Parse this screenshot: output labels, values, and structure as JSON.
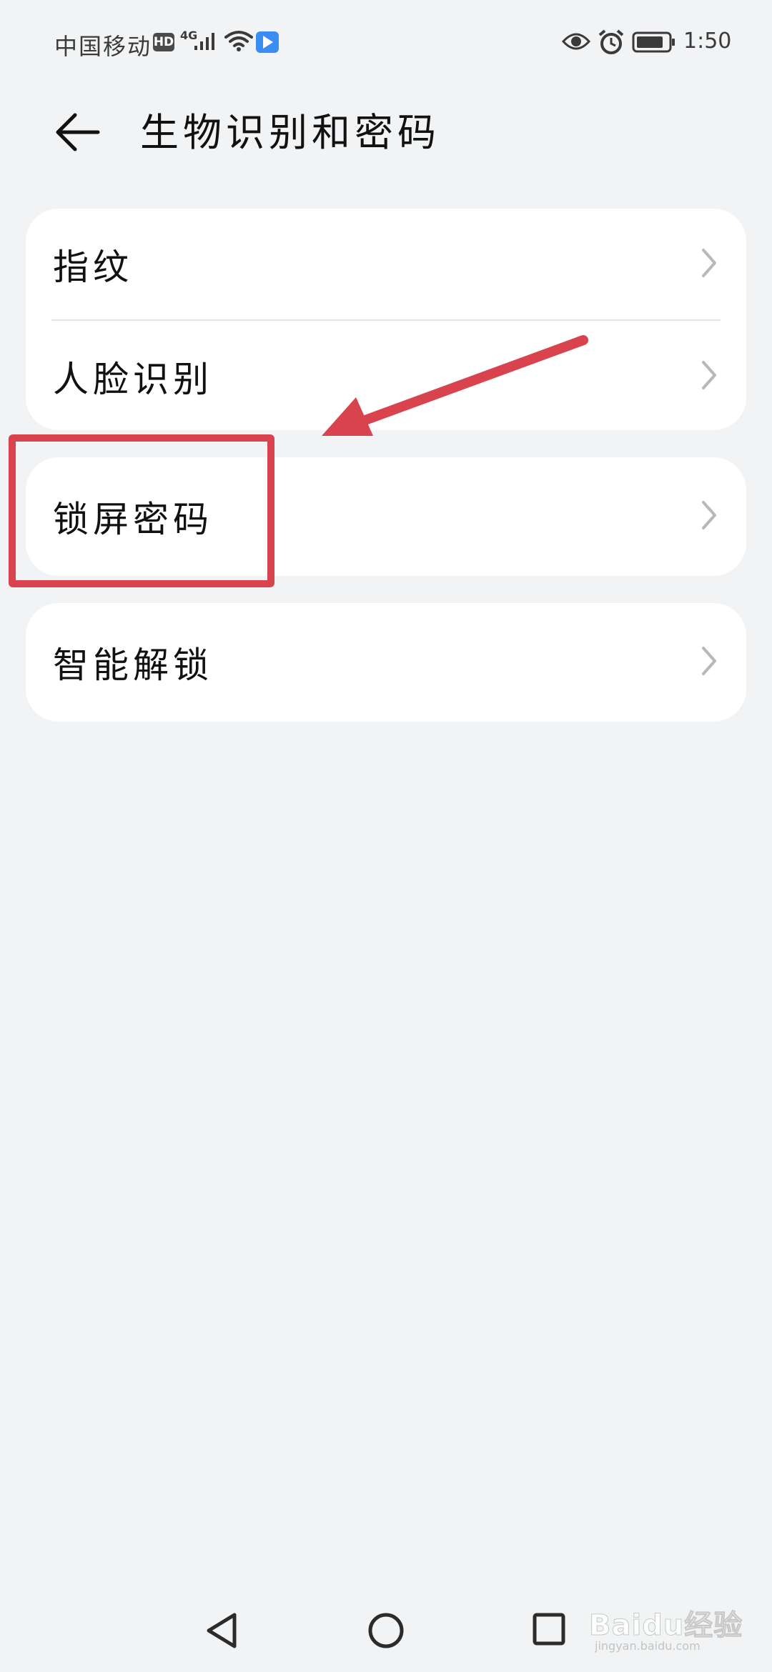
{
  "status_bar": {
    "carrier": "中国移动",
    "hd": "HD",
    "network_type": "4G",
    "time": "1:50",
    "icons": [
      "signal-icon",
      "wifi-icon",
      "app-notification-icon",
      "eye-icon",
      "alarm-icon",
      "battery-icon"
    ]
  },
  "header": {
    "title": "生物识别和密码",
    "back_icon": "arrow-left-icon"
  },
  "menu": {
    "items": [
      {
        "label": "指纹",
        "icon": "chevron-right-icon"
      },
      {
        "label": "人脸识别",
        "icon": "chevron-right-icon"
      },
      {
        "label": "锁屏密码",
        "icon": "chevron-right-icon"
      },
      {
        "label": "智能解锁",
        "icon": "chevron-right-icon"
      }
    ]
  },
  "annotation": {
    "color": "#d9434d",
    "highlighted_item": "锁屏密码"
  },
  "nav_bar": {
    "icons": [
      "nav-back-icon",
      "nav-home-icon",
      "nav-recents-icon"
    ]
  },
  "watermark": {
    "brand": "Baidu经验",
    "url": "jingyan.baidu.com"
  },
  "colors": {
    "background": "#f1f3f5",
    "card": "#ffffff",
    "annotation": "#d9434d"
  }
}
